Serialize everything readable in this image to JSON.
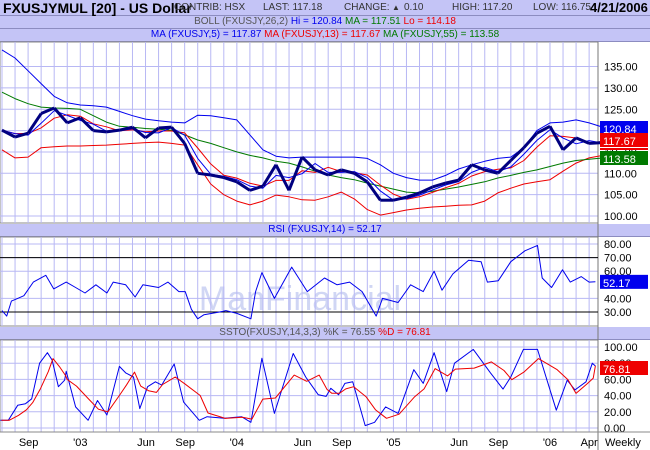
{
  "header": {
    "symbol_title": "FXUSJYMUL [20] - US Dollar",
    "contrib": "CONTRIB: HSX",
    "last": "LAST: 117.18",
    "change_label": "CHANGE:",
    "change_icon": "triangle-up-icon",
    "change_value": "0.10",
    "high": "HIGH: 117.20",
    "low": "LOW: 116.75",
    "date": "4/21/2006"
  },
  "boll_bar": {
    "label": "BOLL (FXUSJY,26,2)",
    "hi": "Hi = 120.84",
    "ma": "MA = 117.51",
    "lo": "Lo = 114.18"
  },
  "ma_bar": {
    "ma5": "MA (FXUSJY,5) = 117.87",
    "ma13": "MA (FXUSJY,13) = 117.67",
    "ma55": "MA (FXUSJY,55) = 113.58"
  },
  "rsi_bar": {
    "label": "RSI (FXUSJY,14) = 52.17"
  },
  "ssto_bar": {
    "label": "SSTO(FXUSJY,14,3,3) %K = 76.55",
    "d": "%D = 76.81"
  },
  "watermark": "ManFinancial",
  "colors": {
    "bar_bg": "#c4c4f6",
    "grid": "#b8b8f4",
    "price": "#000080",
    "boll_upper": "#0000ee",
    "boll_lower": "#ee0000",
    "ma5": "#0000ee",
    "ma13": "#ee0000",
    "ma55": "#007a00",
    "rsi": "#0000ee",
    "k": "#0000ee",
    "d": "#ee0000"
  },
  "chart_data": [
    {
      "type": "line",
      "panel": "price",
      "x_unit": "decimal year",
      "ylim": [
        98,
        140
      ],
      "y_ticks": [
        "100.00",
        "105.00",
        "110.00",
        "115.00",
        "120.00",
        "125.00",
        "130.00",
        "135.00"
      ],
      "y_tick_values": [
        100,
        105,
        110,
        115,
        120,
        125,
        130,
        135
      ],
      "grid": true,
      "badges": [
        {
          "text": "120.84",
          "value": 120.84,
          "color": "#0000ee"
        },
        {
          "text": "117.67",
          "value": 117.67,
          "color": "#ee0000"
        },
        {
          "text": "113.58",
          "value": 113.58,
          "color": "#007a00"
        }
      ],
      "start": 2002.5,
      "step": 0.08333,
      "close": [
        120.1,
        118.5,
        119.4,
        124,
        125.3,
        121.8,
        123,
        120,
        119.7,
        120.1,
        120.8,
        118.3,
        120.6,
        120.8,
        117,
        110,
        109.6,
        109,
        108,
        106,
        107,
        112,
        106,
        113.8,
        110.8,
        109.6,
        110.8,
        110,
        108,
        103.7,
        103.7,
        104.4,
        105.4,
        106.8,
        107.7,
        108.4,
        112,
        110.8,
        110,
        113,
        116,
        119.4,
        121,
        115.5,
        118.3,
        117,
        117.18
      ],
      "boll_upper": [
        138.9,
        137,
        134,
        131,
        128,
        126.5,
        126,
        125.8,
        125.5,
        124.5,
        123.5,
        122.7,
        122.3,
        122,
        121.8,
        123.6,
        123.5,
        123,
        122.5,
        119,
        115.5,
        114,
        113.6,
        113.8,
        113.8,
        113.8,
        113.8,
        113.8,
        113.5,
        112,
        110,
        109,
        108.4,
        108.4,
        109.5,
        111,
        112,
        112.8,
        113.5,
        113.8,
        116,
        120,
        121.8,
        122,
        122.5,
        121.8,
        120.84
      ],
      "boll_lower": [
        115.5,
        113.6,
        113.8,
        116,
        116.2,
        116.4,
        116.4,
        116.5,
        116.6,
        116.8,
        117,
        117.2,
        117.3,
        117,
        116.6,
        112,
        107.5,
        105,
        103.5,
        102.6,
        103.5,
        104.9,
        104.5,
        103.8,
        103.7,
        104.5,
        105.6,
        104,
        101.5,
        100.2,
        100.8,
        101.4,
        101.8,
        102.1,
        102.3,
        102.5,
        102.6,
        103.5,
        105.4,
        106.5,
        107.5,
        108,
        108.5,
        110.5,
        112.4,
        113.6,
        114.18
      ],
      "ma55": [
        129,
        127.5,
        126.3,
        125.5,
        125.3,
        125.2,
        125,
        123.5,
        122,
        121,
        120.8,
        120.5,
        120.3,
        120.1,
        119,
        117.8,
        117,
        116,
        115,
        114.2,
        113.6,
        112.8,
        112.4,
        111.5,
        110.5,
        109.6,
        109,
        108.5,
        107.7,
        107,
        106.3,
        105.6,
        105.4,
        105.8,
        106.3,
        106.8,
        107.4,
        108,
        108.9,
        109.5,
        110.2,
        110.8,
        111.6,
        112.4,
        113,
        113.3,
        113.58
      ]
    },
    {
      "type": "line",
      "panel": "rsi",
      "x_unit": "decimal year",
      "ylim": [
        20,
        85
      ],
      "y_ticks": [
        "30.00",
        "40.00",
        "60.00",
        "70.00",
        "80.00"
      ],
      "y_tick_values": [
        30,
        40,
        60,
        70,
        80
      ],
      "reference_lines": [
        30,
        70
      ],
      "badge": {
        "text": "52.17",
        "value": 52.17,
        "color": "#0000ee"
      },
      "points": [
        [
          2002.5,
          31
        ],
        [
          2002.53,
          27
        ],
        [
          2002.56,
          38
        ],
        [
          2002.6,
          40
        ],
        [
          2002.64,
          42
        ],
        [
          2002.7,
          52
        ],
        [
          2002.78,
          57
        ],
        [
          2002.83,
          47
        ],
        [
          2002.91,
          52
        ],
        [
          2002.97,
          48
        ],
        [
          2003.03,
          44
        ],
        [
          2003.1,
          50
        ],
        [
          2003.17,
          44
        ],
        [
          2003.21,
          52
        ],
        [
          2003.29,
          50
        ],
        [
          2003.35,
          41
        ],
        [
          2003.4,
          50
        ],
        [
          2003.5,
          48
        ],
        [
          2003.56,
          52
        ],
        [
          2003.63,
          45
        ],
        [
          2003.67,
          45
        ],
        [
          2003.71,
          32
        ],
        [
          2003.75,
          25
        ],
        [
          2003.79,
          28
        ],
        [
          2003.89,
          30
        ],
        [
          2003.93,
          31
        ],
        [
          2004.0,
          29
        ],
        [
          2004.09,
          25
        ],
        [
          2004.12,
          45
        ],
        [
          2004.16,
          59
        ],
        [
          2004.24,
          40
        ],
        [
          2004.35,
          63
        ],
        [
          2004.45,
          45
        ],
        [
          2004.56,
          55
        ],
        [
          2004.64,
          50
        ],
        [
          2004.72,
          52
        ],
        [
          2004.8,
          45
        ],
        [
          2004.89,
          27
        ],
        [
          2004.93,
          40
        ],
        [
          2005.03,
          37
        ],
        [
          2005.11,
          50
        ],
        [
          2005.19,
          45
        ],
        [
          2005.26,
          60
        ],
        [
          2005.31,
          46
        ],
        [
          2005.38,
          58
        ],
        [
          2005.48,
          68
        ],
        [
          2005.56,
          67
        ],
        [
          2005.6,
          52
        ],
        [
          2005.67,
          53
        ],
        [
          2005.75,
          67
        ],
        [
          2005.84,
          75
        ],
        [
          2005.92,
          79
        ],
        [
          2005.95,
          55
        ],
        [
          2006.01,
          48
        ],
        [
          2006.08,
          61
        ],
        [
          2006.13,
          52
        ],
        [
          2006.2,
          56
        ],
        [
          2006.25,
          52
        ],
        [
          2006.29,
          52.17
        ]
      ]
    },
    {
      "type": "line",
      "panel": "ssto",
      "x_unit": "decimal year",
      "ylim": [
        -5,
        105
      ],
      "y_ticks": [
        "0.00",
        "20.00",
        "40.00",
        "60.00",
        "80.00",
        "100.00"
      ],
      "y_tick_values": [
        0,
        20,
        40,
        60,
        80,
        100
      ],
      "badge": {
        "text": "76.81",
        "value": 76.81,
        "color": "#ee0000"
      },
      "k_points": [
        [
          2002.49,
          9.5
        ],
        [
          2002.54,
          9.5
        ],
        [
          2002.6,
          28
        ],
        [
          2002.65,
          30
        ],
        [
          2002.69,
          36
        ],
        [
          2002.74,
          80
        ],
        [
          2002.79,
          93
        ],
        [
          2002.82,
          84
        ],
        [
          2002.86,
          51
        ],
        [
          2002.9,
          59
        ],
        [
          2002.91,
          70
        ],
        [
          2002.97,
          26
        ],
        [
          2003.05,
          9.5
        ],
        [
          2003.11,
          34
        ],
        [
          2003.17,
          16
        ],
        [
          2003.25,
          76
        ],
        [
          2003.29,
          68
        ],
        [
          2003.34,
          63
        ],
        [
          2003.38,
          24
        ],
        [
          2003.43,
          51
        ],
        [
          2003.48,
          57
        ],
        [
          2003.52,
          53
        ],
        [
          2003.6,
          79
        ],
        [
          2003.66,
          32
        ],
        [
          2003.76,
          9.5
        ],
        [
          2003.81,
          14
        ],
        [
          2003.92,
          12
        ],
        [
          2004.03,
          14
        ],
        [
          2004.09,
          7
        ],
        [
          2004.16,
          86
        ],
        [
          2004.24,
          18
        ],
        [
          2004.36,
          92
        ],
        [
          2004.44,
          63
        ],
        [
          2004.52,
          41
        ],
        [
          2004.57,
          39
        ],
        [
          2004.6,
          49
        ],
        [
          2004.65,
          41
        ],
        [
          2004.69,
          55
        ],
        [
          2004.74,
          57
        ],
        [
          2004.82,
          3
        ],
        [
          2004.88,
          7
        ],
        [
          2004.95,
          26
        ],
        [
          2005.03,
          18
        ],
        [
          2005.13,
          72
        ],
        [
          2005.19,
          55
        ],
        [
          2005.26,
          93
        ],
        [
          2005.34,
          45
        ],
        [
          2005.39,
          80
        ],
        [
          2005.51,
          97
        ],
        [
          2005.62,
          68
        ],
        [
          2005.7,
          48
        ],
        [
          2005.75,
          63
        ],
        [
          2005.83,
          97
        ],
        [
          2005.92,
          97
        ],
        [
          2006.04,
          22
        ],
        [
          2006.11,
          59
        ],
        [
          2006.16,
          47
        ],
        [
          2006.23,
          57
        ],
        [
          2006.27,
          80
        ],
        [
          2006.29,
          76.55
        ]
      ],
      "d_last": 76.81
    }
  ],
  "x_axis": {
    "ticks": [
      {
        "label": "Sep",
        "t": 2002.67
      },
      {
        "label": "'03",
        "t": 2003.0
      },
      {
        "label": "Jun",
        "t": 2003.42
      },
      {
        "label": "Sep",
        "t": 2003.67
      },
      {
        "label": "'04",
        "t": 2004.0
      },
      {
        "label": "Jun",
        "t": 2004.42
      },
      {
        "label": "Sep",
        "t": 2004.67
      },
      {
        "label": "'05",
        "t": 2005.0
      },
      {
        "label": "Jun",
        "t": 2005.42
      },
      {
        "label": "Sep",
        "t": 2005.67
      },
      {
        "label": "'06",
        "t": 2006.0
      },
      {
        "label": "Apr",
        "t": 2006.25
      }
    ],
    "period": "Weekly"
  }
}
